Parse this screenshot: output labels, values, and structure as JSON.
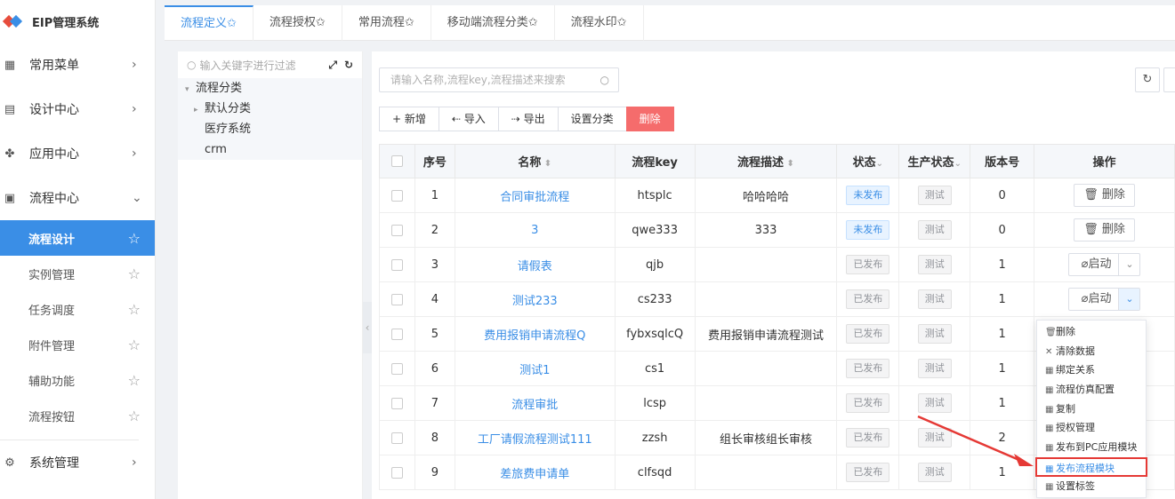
{
  "app": {
    "title": "EIP管理系统"
  },
  "sidebar": {
    "menus": [
      {
        "label": "常用菜单",
        "icon": "grid-icon",
        "glyph": "▦",
        "arrow": "›"
      },
      {
        "label": "设计中心",
        "icon": "design-icon",
        "glyph": "▤",
        "arrow": "›"
      },
      {
        "label": "应用中心",
        "icon": "apps-icon",
        "glyph": "✤",
        "arrow": "›"
      },
      {
        "label": "流程中心",
        "icon": "flow-icon",
        "glyph": "▣",
        "arrow": "⌄"
      }
    ],
    "sub_items": [
      {
        "label": "流程设计",
        "active": true
      },
      {
        "label": "实例管理"
      },
      {
        "label": "任务调度"
      },
      {
        "label": "附件管理"
      },
      {
        "label": "辅助功能"
      },
      {
        "label": "流程按钮"
      }
    ],
    "bottom_menu": {
      "label": "系统管理",
      "arrow": "›"
    }
  },
  "tabs": [
    "流程定义✩",
    "流程授权✩",
    "常用流程✩",
    "移动端流程分类✩",
    "流程水印✩"
  ],
  "tree": {
    "search_placeholder": "输入关键字进行过滤",
    "root": "流程分类",
    "nodes": [
      "默认分类",
      "医疗系统",
      "crm"
    ]
  },
  "main": {
    "search_placeholder": "请输入名称,流程key,流程描述来搜索",
    "toolbar": {
      "add": "+ 新增",
      "import": "⇠ 导入",
      "export": "⇢ 导出",
      "set_category": "设置分类",
      "delete": "删除"
    },
    "table": {
      "headers": [
        "序号",
        "名称",
        "流程key",
        "流程描述",
        "状态",
        "生产状态",
        "版本号",
        "操作"
      ],
      "rows": [
        {
          "no": "1",
          "name": "合同审批流程",
          "key": "htsplc",
          "desc": "哈哈哈哈",
          "status": "未发布",
          "prod": "测试",
          "version": "0",
          "op": "删除"
        },
        {
          "no": "2",
          "name": "3",
          "key": "qwe333",
          "desc": "333",
          "status": "未发布",
          "prod": "测试",
          "version": "0",
          "op": "删除"
        },
        {
          "no": "3",
          "name": "请假表",
          "key": "qjb",
          "desc": "",
          "status": "已发布",
          "prod": "测试",
          "version": "1",
          "op": "启动"
        },
        {
          "no": "4",
          "name": "测试233",
          "key": "cs233",
          "desc": "",
          "status": "已发布",
          "prod": "测试",
          "version": "1",
          "op": "启动"
        },
        {
          "no": "5",
          "name": "费用报销申请流程Q",
          "key": "fybxsqlcQ",
          "desc": "费用报销申请流程测试",
          "status": "已发布",
          "prod": "测试",
          "version": "1",
          "op": ""
        },
        {
          "no": "6",
          "name": "测试1",
          "key": "cs1",
          "desc": "",
          "status": "已发布",
          "prod": "测试",
          "version": "1",
          "op": ""
        },
        {
          "no": "7",
          "name": "流程审批",
          "key": "lcsp",
          "desc": "",
          "status": "已发布",
          "prod": "测试",
          "version": "1",
          "op": ""
        },
        {
          "no": "8",
          "name": "工厂请假流程测试111",
          "key": "zzsh",
          "desc": "组长审核组长审核",
          "status": "已发布",
          "prod": "测试",
          "version": "2",
          "op": ""
        },
        {
          "no": "9",
          "name": "差旅费申请单",
          "key": "clfsqd",
          "desc": "",
          "status": "已发布",
          "prod": "测试",
          "version": "1",
          "op": ""
        }
      ]
    },
    "dropdown": [
      {
        "label": "删除",
        "icon": "trash-icon",
        "glyph": "🗑"
      },
      {
        "label": "清除数据",
        "icon": "close-icon",
        "glyph": "✕"
      },
      {
        "label": "绑定关系",
        "icon": "grid-icon",
        "glyph": "▦"
      },
      {
        "label": "流程仿真配置",
        "icon": "grid-icon",
        "glyph": "▦"
      },
      {
        "label": "复制",
        "icon": "grid-icon",
        "glyph": "▦"
      },
      {
        "label": "授权管理",
        "icon": "grid-icon",
        "glyph": "▦"
      },
      {
        "label": "发布到PC应用模块",
        "icon": "grid-icon",
        "glyph": "▦"
      },
      {
        "label": "发布流程模块",
        "icon": "grid-icon",
        "glyph": "▦",
        "highlight": true
      },
      {
        "label": "设置标签",
        "icon": "grid-icon",
        "glyph": "▦"
      }
    ]
  },
  "colors": {
    "primary": "#3a8ee6",
    "danger": "#f56c6c",
    "highlight": "#e53935"
  }
}
